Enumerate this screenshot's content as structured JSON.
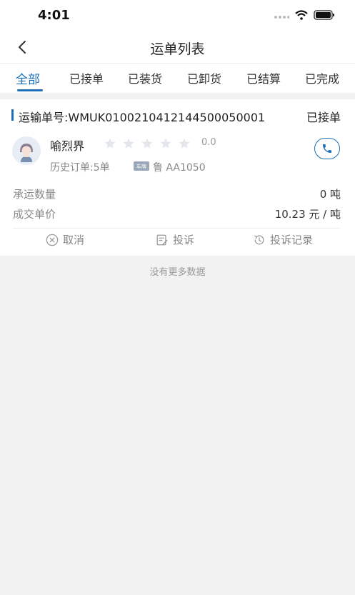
{
  "status_bar": {
    "time": "4:01"
  },
  "nav": {
    "title": "运单列表"
  },
  "tabs": [
    {
      "label": "全部"
    },
    {
      "label": "已接单"
    },
    {
      "label": "已装货"
    },
    {
      "label": "已卸货"
    },
    {
      "label": "已结算"
    },
    {
      "label": "已完成"
    }
  ],
  "order": {
    "number_label": "运输单号:WMUK0100210412144500050001",
    "status": "已接单",
    "driver_name": "喻烈界",
    "rating": "0.0",
    "history": "历史订单:5单",
    "plate_icon": "车牌",
    "plate": "鲁 AA1050",
    "quantity_label": "承运数量",
    "quantity_value": "0 吨",
    "price_label": "成交单价",
    "price_value": "10.23 元 / 吨",
    "actions": {
      "cancel": "取消",
      "complain": "投诉",
      "complain_records": "投诉记录"
    }
  },
  "footer": {
    "no_more": "没有更多数据"
  },
  "colors": {
    "accent": "#1f6fb8",
    "muted": "#888888"
  }
}
